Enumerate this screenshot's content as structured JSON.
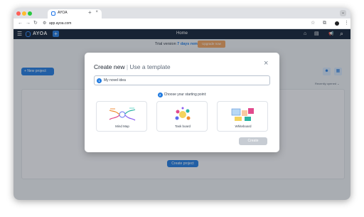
{
  "browser": {
    "tab_title": "AYOA",
    "tab_close": "×",
    "new_tab": "+",
    "url": "app.ayoa.com",
    "tabstrip_menu": "⌄",
    "back": "←",
    "forward": "→",
    "reload": "↻",
    "star": "☆",
    "extensions": "⧉",
    "menu": "⋮",
    "traffic_colors": [
      "#ff5f57",
      "#febc2e",
      "#28c840"
    ]
  },
  "app": {
    "logo": "AYOA",
    "title": "Home",
    "hamburger": "☰",
    "plus": "+",
    "home_icon": "⌂",
    "announce_icon": "📢",
    "search_icon": "⌕",
    "panel_icon": "▤",
    "accent_color": "#1f7ae0"
  },
  "trial": {
    "prefix": "Trial version",
    "days": "7 days remaining",
    "upgrade": "Upgrade now"
  },
  "page": {
    "new_project": "New project",
    "new_project_plus": "+",
    "sort": "Recently opened",
    "sort_chevron": "⌄",
    "create_project": "Create project",
    "view_icon_1": "☻",
    "view_icon_2": "▦"
  },
  "modal": {
    "title_create": "Create new",
    "title_sep": " | ",
    "title_template": "Use a template",
    "close": "×",
    "step1": "1",
    "step2": "2",
    "input_value": "My novel idea",
    "starting_point": "Choose your starting point:",
    "cards": [
      {
        "label": "Mind Map",
        "icon": "mind-map-illustration"
      },
      {
        "label": "Task board",
        "icon": "task-board-illustration"
      },
      {
        "label": "Whiteboard",
        "icon": "whiteboard-illustration"
      }
    ],
    "create": "Create"
  }
}
